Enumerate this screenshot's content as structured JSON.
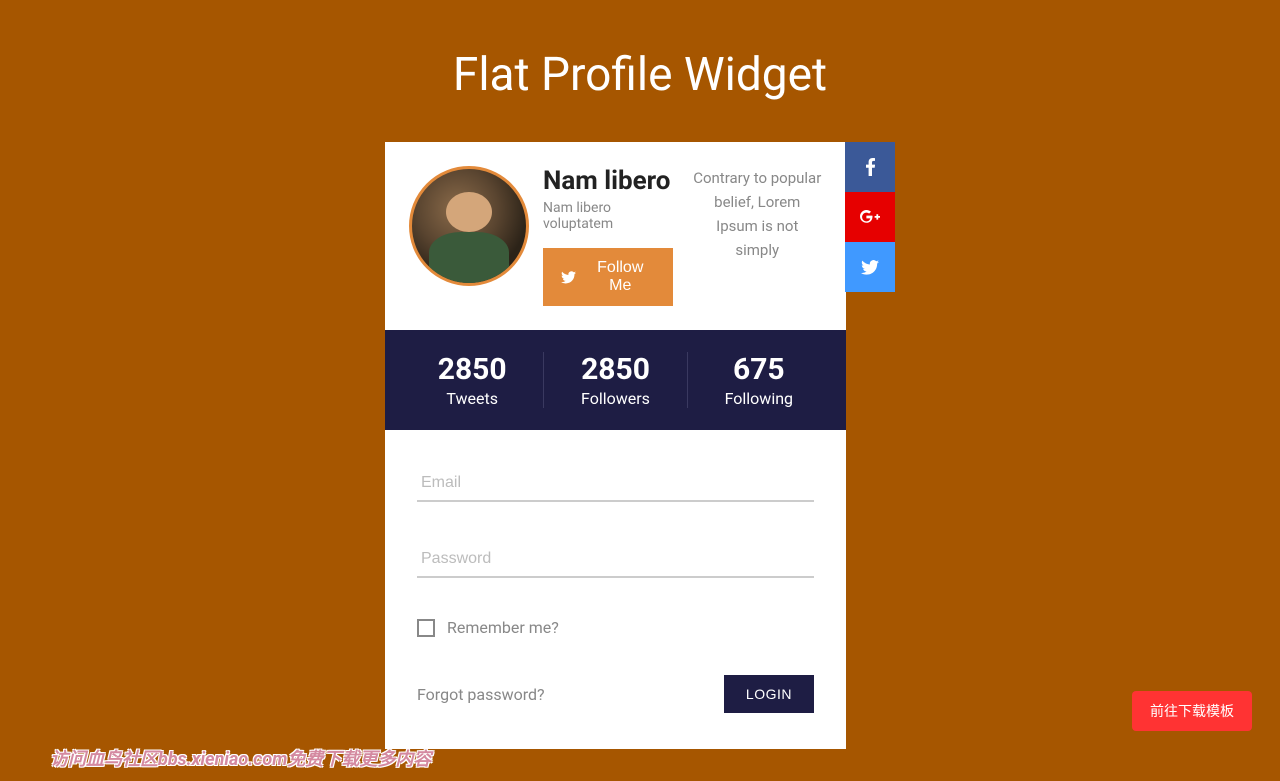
{
  "page": {
    "title": "Flat Profile Widget"
  },
  "profile": {
    "name": "Nam libero",
    "tagline": "Nam libero voluptatem",
    "description": "Contrary to popular belief, Lorem Ipsum is not simply",
    "follow_label": "Follow Me"
  },
  "stats": {
    "tweets_count": "2850",
    "tweets_label": "Tweets",
    "followers_count": "2850",
    "followers_label": "Followers",
    "following_count": "675",
    "following_label": "Following"
  },
  "form": {
    "email_placeholder": "Email",
    "password_placeholder": "Password",
    "remember_label": "Remember me?",
    "forgot_label": "Forgot password?",
    "login_label": "LOGIN"
  },
  "social": {
    "fb": "facebook",
    "gp": "google-plus",
    "tw": "twitter"
  },
  "float_button": "前往下载模板",
  "watermark": "访问血鸟社区bbs.xieniao.com免费下载更多内容"
}
